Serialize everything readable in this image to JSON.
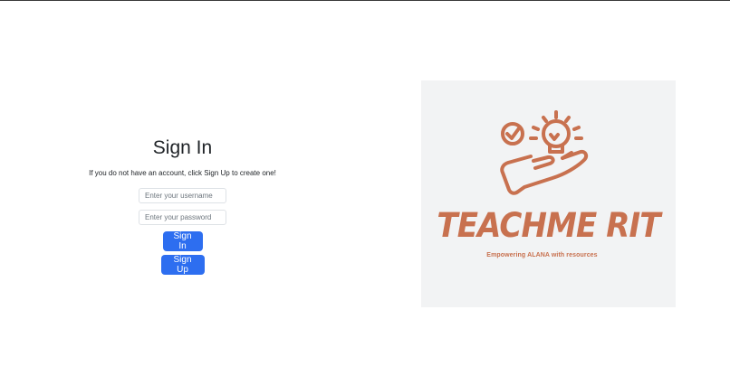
{
  "signin": {
    "title": "Sign In",
    "hint": "If you do not have an account, click Sign Up to create one!",
    "username_placeholder": "Enter your username",
    "password_placeholder": "Enter your password",
    "signin_label": "Sign In",
    "signup_label": "Sign Up"
  },
  "brand": {
    "name": "TEACHME RIT",
    "tagline": "Empowering ALANA with resources",
    "logo_icon": "hand-lightbulb-checkmark-icon",
    "color": "#c8714f"
  },
  "colors": {
    "button": "#2d6ef0",
    "logo_background": "#f2f3f4"
  }
}
